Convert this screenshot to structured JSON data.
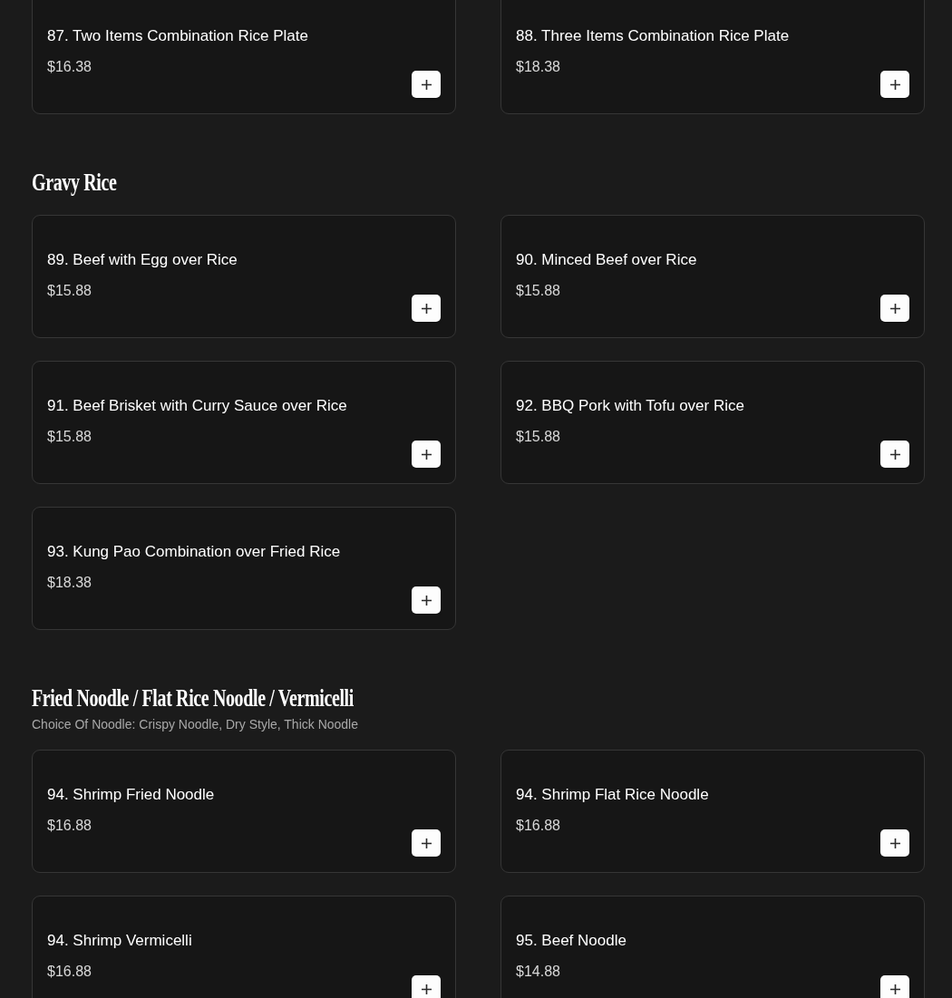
{
  "sections": [
    {
      "items": [
        {
          "name": "87. Two Items Combination Rice Plate",
          "price": "$16.38"
        },
        {
          "name": "88. Three Items Combination Rice Plate",
          "price": "$18.38"
        }
      ]
    },
    {
      "title": "Gravy Rice",
      "items": [
        {
          "name": "89. Beef with Egg over Rice",
          "price": "$15.88"
        },
        {
          "name": "90. Minced Beef over Rice",
          "price": "$15.88"
        },
        {
          "name": "91. Beef Brisket with Curry Sauce over Rice",
          "price": "$15.88"
        },
        {
          "name": "92. BBQ Pork with Tofu over Rice",
          "price": "$15.88"
        },
        {
          "name": "93. Kung Pao Combination over Fried Rice",
          "price": "$18.38"
        }
      ]
    },
    {
      "title": "Fried Noodle / Flat Rice Noodle / Vermicelli",
      "subtitle": "Choice Of Noodle: Crispy Noodle, Dry Style, Thick Noodle",
      "items": [
        {
          "name": "94. Shrimp Fried Noodle",
          "price": "$16.88"
        },
        {
          "name": "94. Shrimp Flat Rice Noodle",
          "price": "$16.88"
        },
        {
          "name": "94. Shrimp Vermicelli",
          "price": "$16.88"
        },
        {
          "name": "95. Beef Noodle",
          "price": "$14.88"
        }
      ]
    }
  ]
}
